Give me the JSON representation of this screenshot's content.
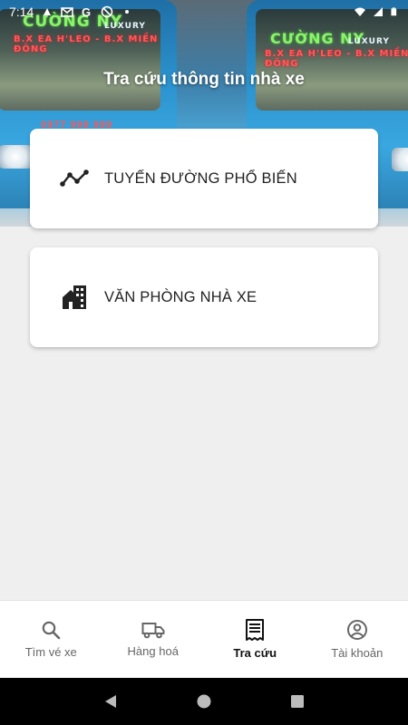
{
  "status_bar": {
    "time": "7:14",
    "left_icons": [
      "notification-icon",
      "mail-icon",
      "google-icon",
      "blocked-icon",
      "dot-icon"
    ],
    "right_icons": [
      "wifi-icon",
      "signal-icon",
      "battery-icon"
    ]
  },
  "hero": {
    "bus_brand_left": "CƯỜNG NY",
    "bus_brand_left_suffix": "LUXURY",
    "route_left": "B.X EA H'LEO - B.X MIỀN ĐÔNG",
    "plate_left": "0977 999 999",
    "bus_brand_right": "CƯỜNG NY",
    "bus_brand_right_suffix": "LUXURY",
    "route_right": "B.X EA H'LEO - B.X MIỀN ĐÔNG"
  },
  "page": {
    "title": "Tra cứu thông tin nhà xe"
  },
  "cards": [
    {
      "label": "TUYẾN ĐƯỜNG PHỔ BIẾN",
      "icon": "route-chart-icon"
    },
    {
      "label": "VĂN PHÒNG NHÀ XE",
      "icon": "office-building-icon"
    }
  ],
  "bottom_nav": [
    {
      "label": "Tìm vé xe",
      "icon": "search-icon",
      "active": false
    },
    {
      "label": "Hàng hoá",
      "icon": "truck-icon",
      "active": false
    },
    {
      "label": "Tra cứu",
      "icon": "receipt-icon",
      "active": true
    },
    {
      "label": "Tài khoản",
      "icon": "account-icon",
      "active": false
    }
  ],
  "android_nav": [
    "back-icon",
    "home-icon",
    "recents-icon"
  ],
  "colors": {
    "accent_active": "#111111",
    "inactive": "#666666",
    "background": "#efefef"
  }
}
